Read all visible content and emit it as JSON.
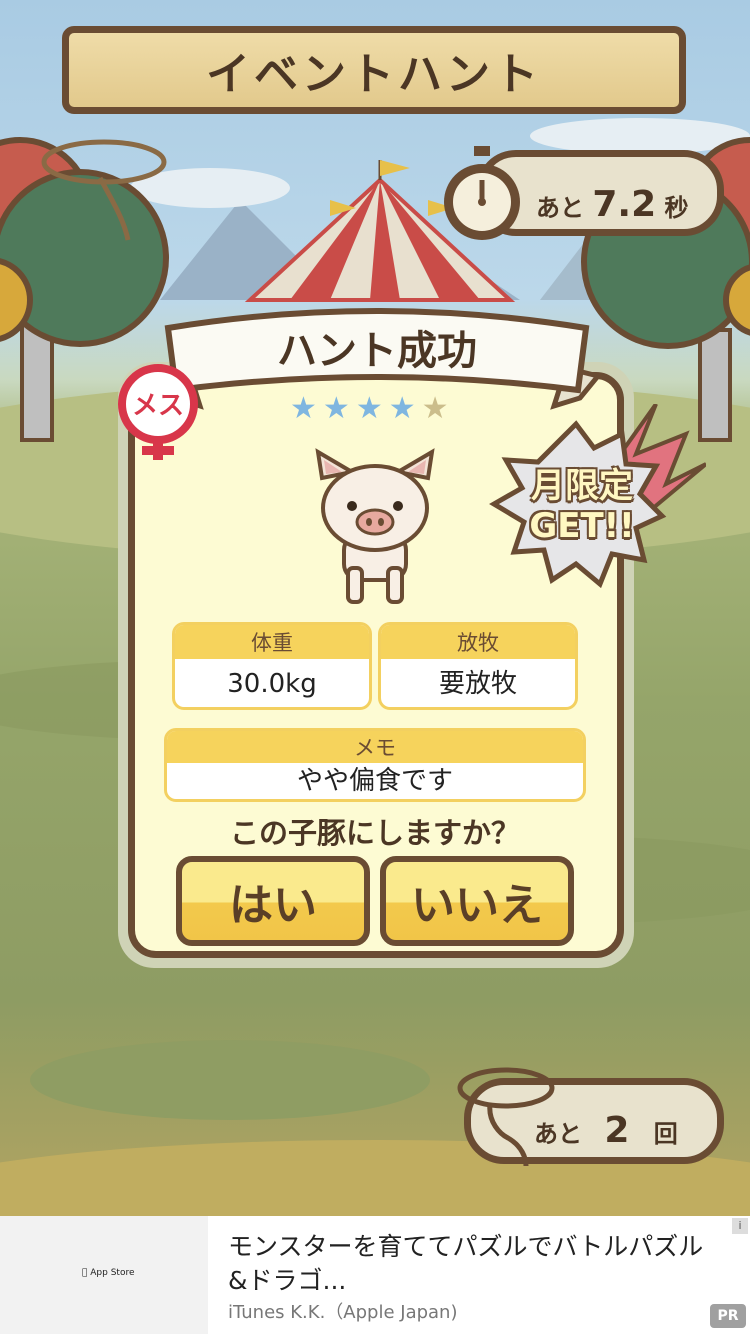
{
  "header": {
    "title": "イベントハント"
  },
  "timer": {
    "prefix": "あと",
    "value": "7.2",
    "unit": "秒",
    "icon": "stopwatch-icon"
  },
  "result": {
    "title": "ハント成功",
    "rating": {
      "filled": 4,
      "total": 5
    },
    "sex_badge": "メス",
    "limited_badge": {
      "line1": "月限定",
      "line2": "GET!!"
    },
    "weight": {
      "label": "体重",
      "value": "30.0kg"
    },
    "grazing": {
      "label": "放牧",
      "value": "要放牧"
    },
    "memo": {
      "label": "メモ",
      "value": "やや偏食です"
    },
    "question": "この子豚にしますか？",
    "yes_label": "はい",
    "no_label": "いいえ"
  },
  "remaining": {
    "prefix": "あと",
    "value": "2",
    "unit": "回",
    "icon": "lasso-icon"
  },
  "ad": {
    "store_label": "App Store",
    "title": "モンスターを育ててパズルでバトルパズル&ドラゴ...",
    "publisher": "iTunes K.K.（Apple Japan)",
    "info_label": "i",
    "pr_label": "PR"
  },
  "colors": {
    "wood": "#6a4c33",
    "panel": "#fdfbd3",
    "yellow": "#f6d35c",
    "star": "#7fb6e0",
    "badge_red": "#d8364a"
  }
}
